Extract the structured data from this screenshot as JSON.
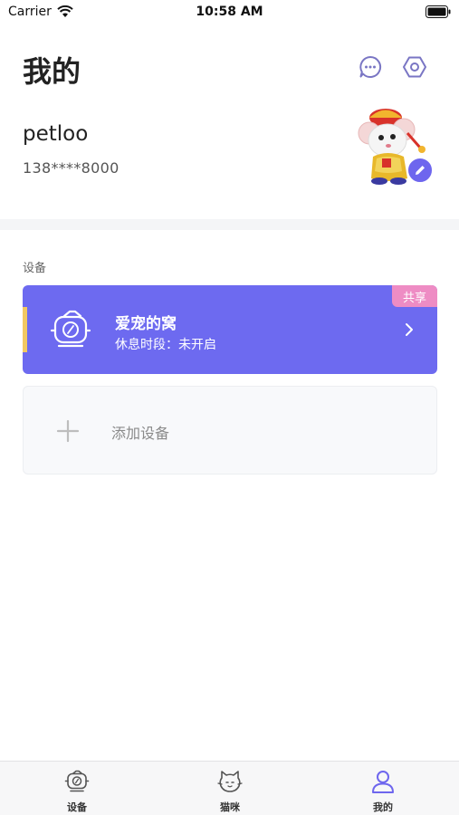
{
  "status_bar": {
    "carrier": "Carrier",
    "time": "10:58 AM"
  },
  "header": {
    "title": "我的",
    "message_icon": "message-icon",
    "settings_icon": "settings-icon"
  },
  "profile": {
    "username": "petloo",
    "phone": "138****8000",
    "avatar_icon": "mouse-mascot-avatar",
    "edit_icon": "pencil-icon"
  },
  "devices_section": {
    "label": "设备",
    "device": {
      "name": "爱宠的窝",
      "status": "休息时段：未开启",
      "badge": "共享"
    },
    "add_device_label": "添加设备"
  },
  "tab_bar": {
    "tabs": [
      {
        "label": "设备",
        "icon": "pet-house-icon"
      },
      {
        "label": "猫咪",
        "icon": "cat-icon"
      },
      {
        "label": "我的",
        "icon": "person-icon"
      }
    ],
    "active_color": "#6e66ee"
  },
  "colors": {
    "accent": "#6d6af0",
    "share_badge": "#ee8cc4",
    "card_accent": "#f2c861"
  }
}
